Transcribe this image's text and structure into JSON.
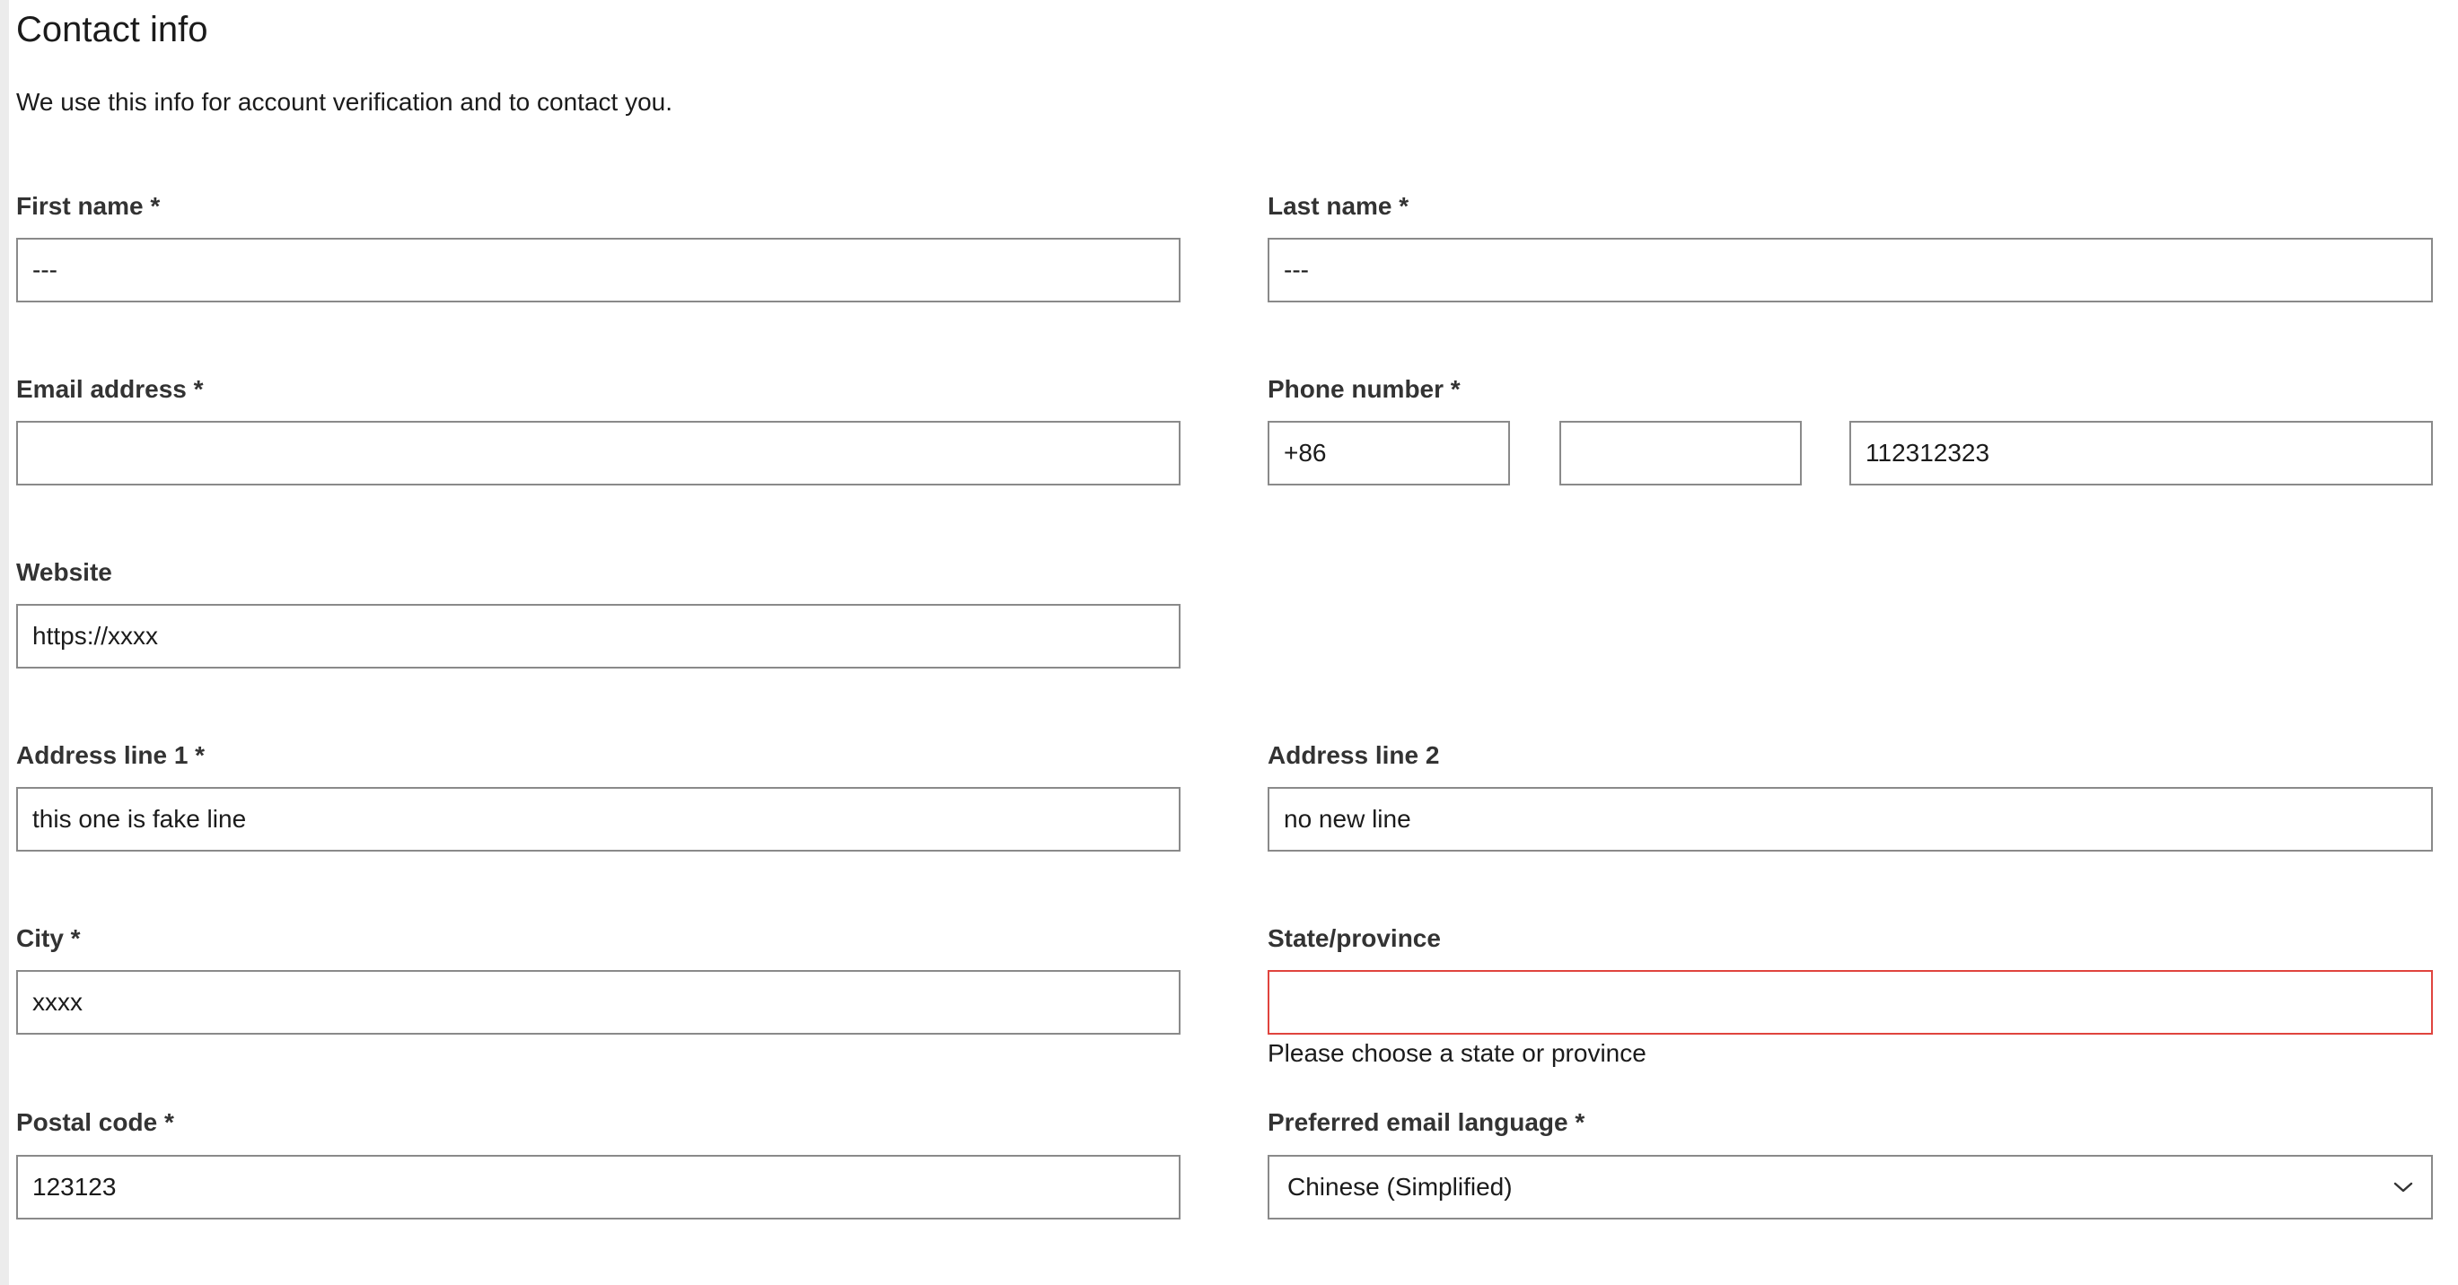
{
  "form": {
    "title": "Contact info",
    "description": "We use this info for account verification and to contact you.",
    "first_name": {
      "label": "First name *",
      "value": "---"
    },
    "last_name": {
      "label": "Last name *",
      "value": "---"
    },
    "email": {
      "label": "Email address *",
      "value": ""
    },
    "phone": {
      "label": "Phone number *",
      "country_code": "+86",
      "area_code": "",
      "number": "112312323"
    },
    "website": {
      "label": "Website",
      "value": "https://xxxx"
    },
    "address1": {
      "label": "Address line 1 *",
      "value": "this one is fake line"
    },
    "address2": {
      "label": "Address line 2",
      "value": "no new line"
    },
    "city": {
      "label": "City *",
      "value": "xxxx"
    },
    "state": {
      "label": "State/province",
      "value": "",
      "error": "Please choose a state or province"
    },
    "postal": {
      "label": "Postal code *",
      "value": "123123"
    },
    "language": {
      "label": "Preferred email language *",
      "selected": "Chinese (Simplified)"
    }
  },
  "colors": {
    "border": "#8a8a8a",
    "error_border": "#e0443e",
    "text": "#1b1b1b"
  },
  "icons": {
    "dropdown": "chevron-down-icon"
  }
}
